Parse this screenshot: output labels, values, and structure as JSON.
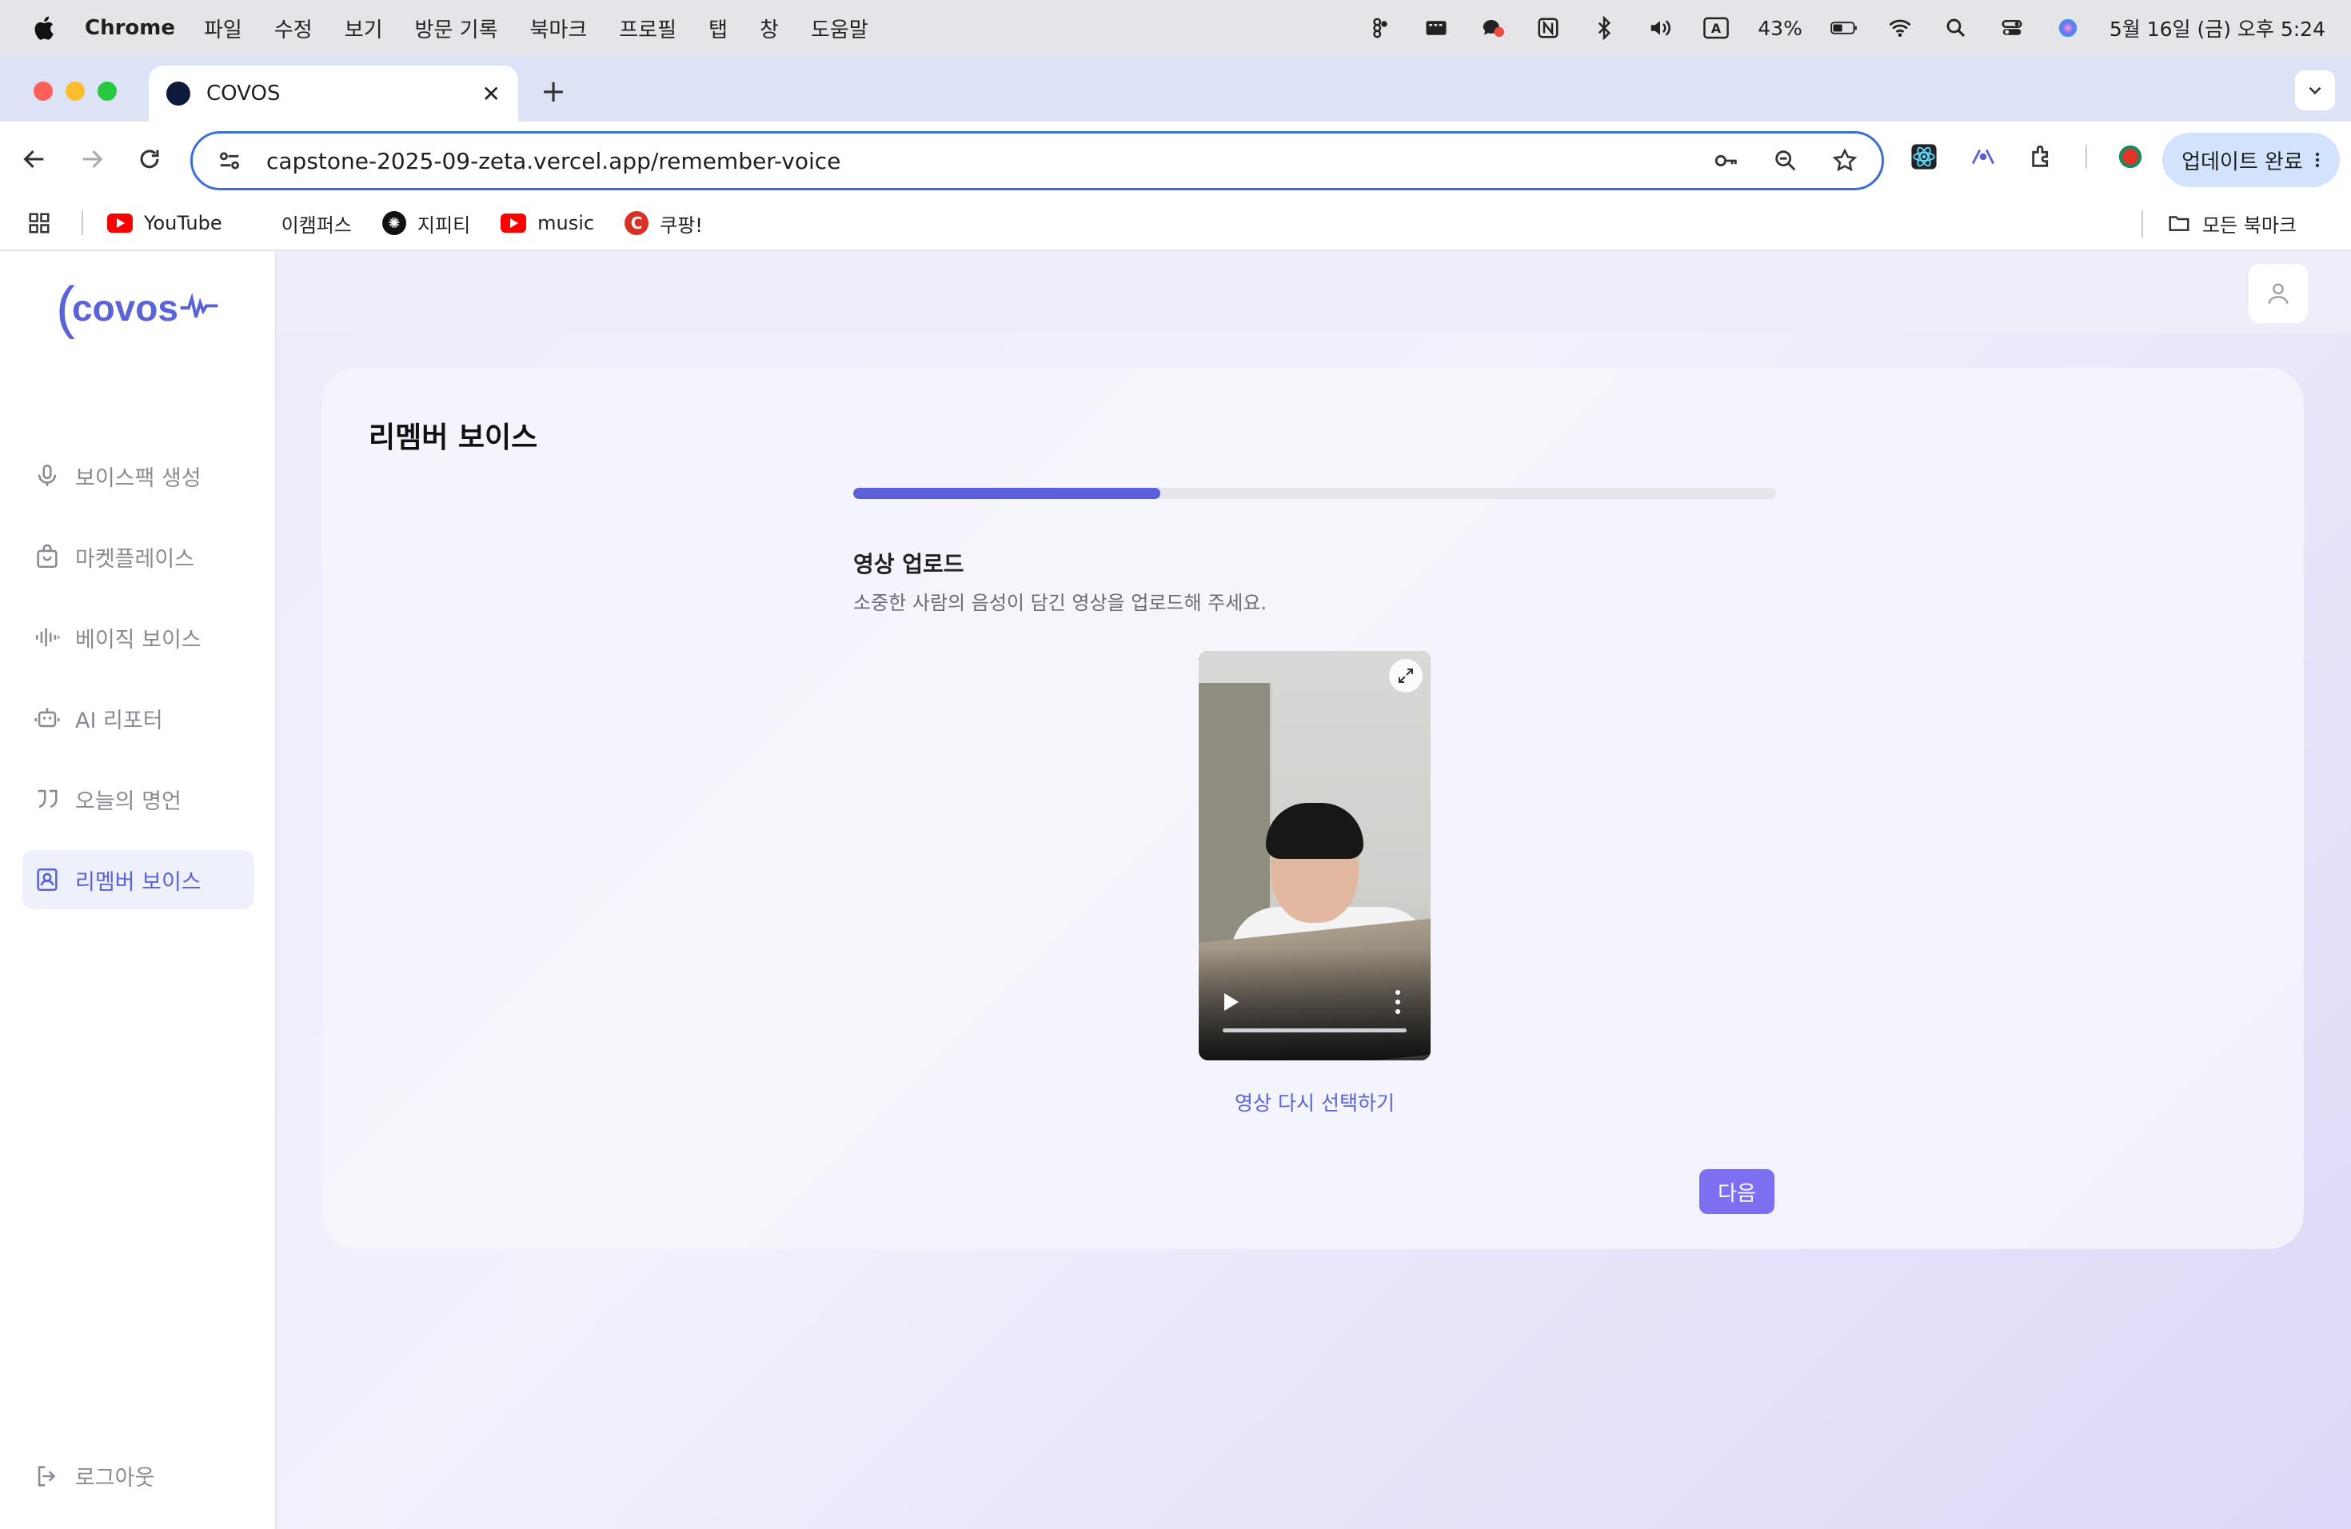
{
  "menubar": {
    "app_name": "Chrome",
    "items": [
      "파일",
      "수정",
      "보기",
      "방문 기록",
      "북마크",
      "프로필",
      "탭",
      "창",
      "도움말"
    ],
    "battery": "43%",
    "datetime": "5월 16일 (금) 오후 5:24",
    "status_icons": [
      "figma-icon",
      "screen-icon",
      "chat-icon",
      "notion-icon",
      "bluetooth-icon",
      "volume-icon",
      "input-source-icon",
      "battery-icon",
      "wifi-icon",
      "spotlight-icon",
      "control-center-icon",
      "siri-icon"
    ],
    "input_source": "A"
  },
  "tabs": [
    {
      "title": "COVOS",
      "active": true
    }
  ],
  "toolbar": {
    "url": "capstone-2025-09-zeta.vercel.app/remember-voice",
    "update_label": "업데이트 완료"
  },
  "bookmarks": {
    "items": [
      {
        "label": "YouTube",
        "icon": "youtube-icon"
      },
      {
        "label": "이캠퍼스",
        "icon": "none"
      },
      {
        "label": "지피티",
        "icon": "chatgpt-icon"
      },
      {
        "label": "music",
        "icon": "youtube-icon"
      },
      {
        "label": "쿠팡!",
        "icon": "coupang-icon"
      }
    ],
    "all_label": "모든 북마크"
  },
  "sidebar": {
    "logo_text": "covos",
    "items": [
      {
        "label": "보이스팩 생성",
        "icon": "microphone-icon",
        "active": false
      },
      {
        "label": "마켓플레이스",
        "icon": "shopping-bag-icon",
        "active": false
      },
      {
        "label": "베이직 보이스",
        "icon": "waveform-icon",
        "active": false
      },
      {
        "label": "AI 리포터",
        "icon": "robot-icon",
        "active": false
      },
      {
        "label": "오늘의 명언",
        "icon": "quote-icon",
        "active": false
      },
      {
        "label": "리멤버 보이스",
        "icon": "contact-book-icon",
        "active": true
      }
    ],
    "logout_label": "로그아웃"
  },
  "main": {
    "title": "리멤버 보이스",
    "progress": 0.333,
    "step_title": "영상 업로드",
    "step_description": "소중한 사람의 음성이 담긴 영상을 업로드해 주세요.",
    "reselect_label": "영상 다시 선택하기",
    "next_label": "다음"
  },
  "colors": {
    "accent": "#5b5fd9",
    "button": "#7c6ff0",
    "active_nav_bg": "#eef0fb",
    "url_border": "#3b6fd6"
  }
}
